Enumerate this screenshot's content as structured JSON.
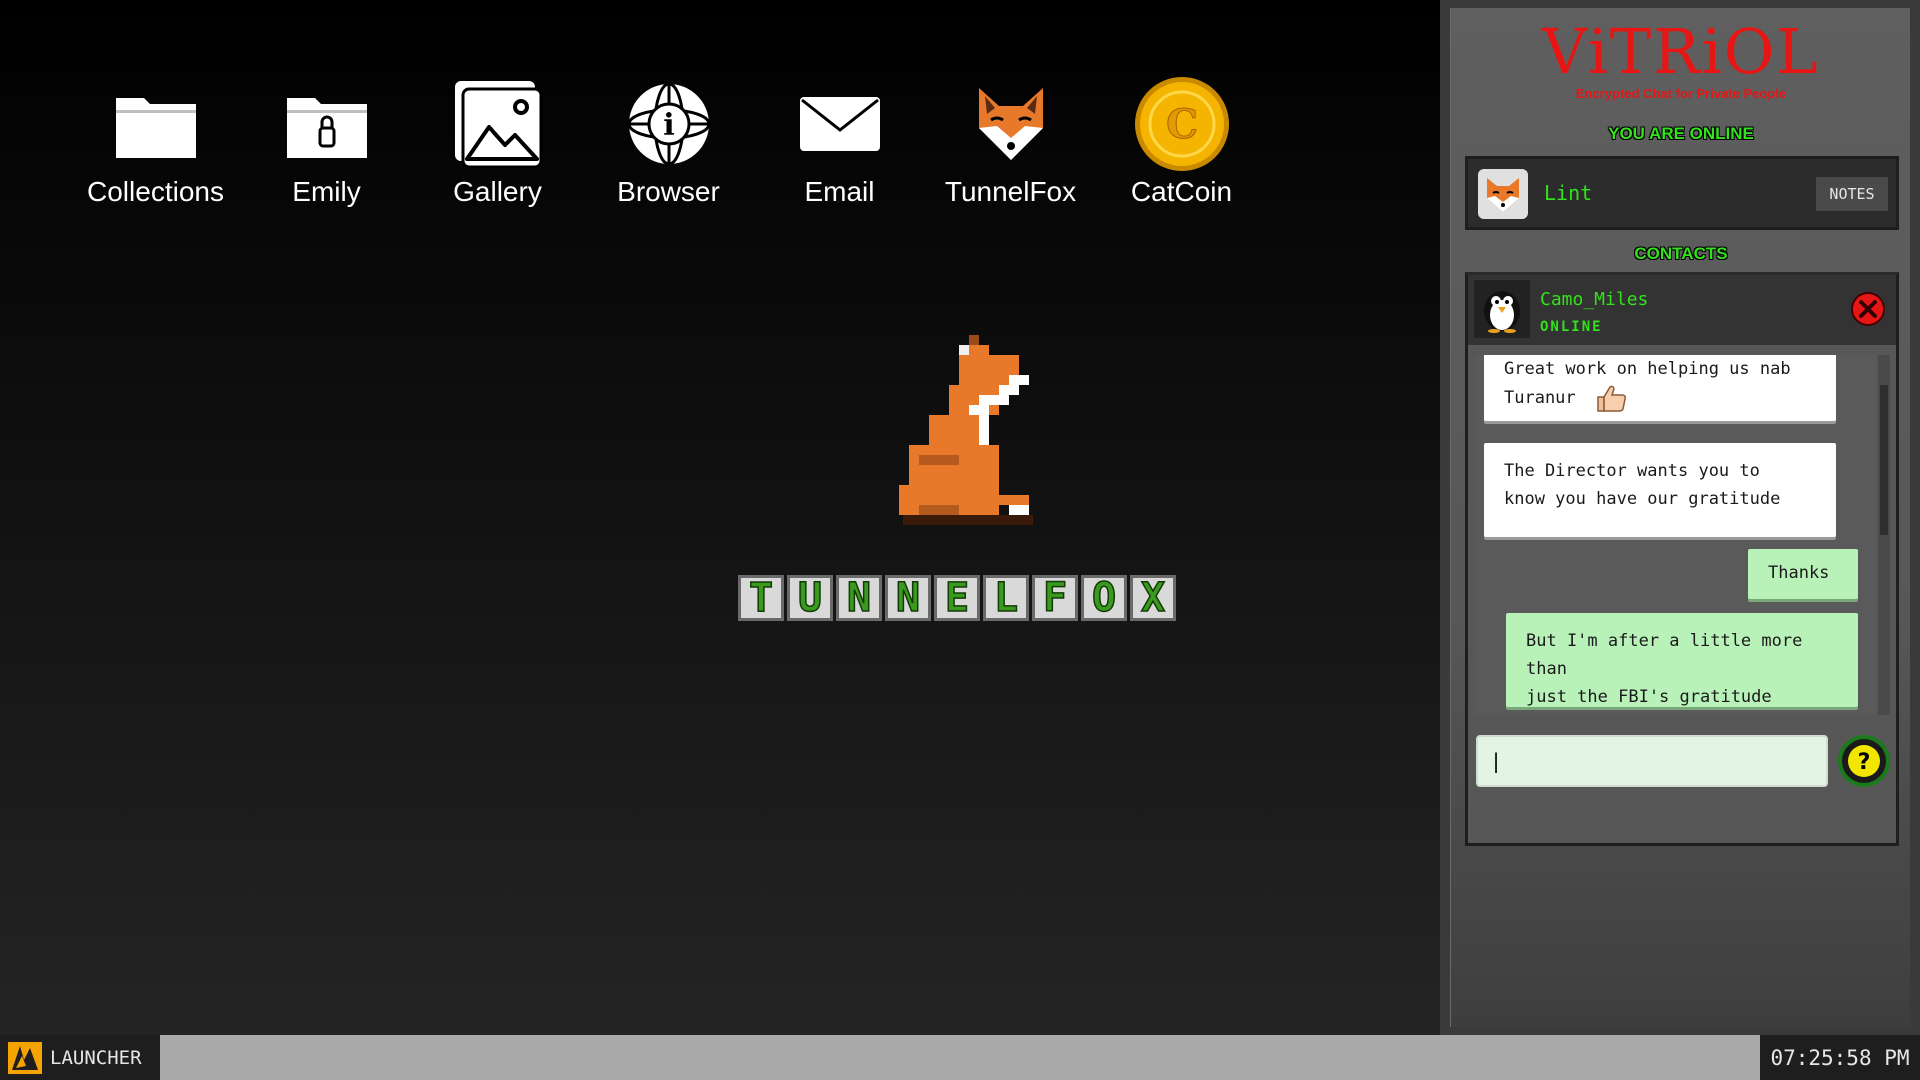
{
  "desktop": {
    "icons": [
      {
        "label": "Collections",
        "icon": "folder-icon"
      },
      {
        "label": "Emily",
        "icon": "locked-folder-icon"
      },
      {
        "label": "Gallery",
        "icon": "image-icon"
      },
      {
        "label": "Browser",
        "icon": "globe-info-icon"
      },
      {
        "label": "Email",
        "icon": "envelope-icon"
      },
      {
        "label": "TunnelFox",
        "icon": "fox-icon"
      },
      {
        "label": "CatCoin",
        "icon": "coin-icon"
      }
    ],
    "logo": {
      "letters": [
        "T",
        "U",
        "N",
        "N",
        "E",
        "L",
        "F",
        "O",
        "X"
      ]
    }
  },
  "chat": {
    "title": "ViTRiOL",
    "subtitle": "Encrypted Chat for Private People",
    "status": "YOU ARE ONLINE",
    "user": {
      "name": "Lint",
      "avatar": "fox-avatar-icon"
    },
    "notes_label": "NOTES",
    "contacts_heading": "CONTACTS",
    "contact": {
      "name": "Camo_Miles",
      "status": "ONLINE",
      "avatar": "penguin-avatar-icon"
    },
    "messages": [
      {
        "from": "them",
        "line1": "Great work on helping us nab",
        "line2": "Turanur"
      },
      {
        "from": "them",
        "line1": "The Director wants you to",
        "line2": "know you have our gratitude"
      },
      {
        "from": "me",
        "line1": "Thanks",
        "line2": ""
      },
      {
        "from": "me",
        "line1": "But I'm after a little more than",
        "line2": "just the FBI's gratitude"
      }
    ],
    "input_value": "|"
  },
  "taskbar": {
    "launcher_label": "LAUNCHER",
    "clock": "07:25:58 PM"
  },
  "colors": {
    "accent_green": "#33e11c",
    "title_red": "#e81515",
    "bubble_in": "#ffffff",
    "bubble_out": "#b9f2b9",
    "taskbar": "#a9a9a9"
  }
}
